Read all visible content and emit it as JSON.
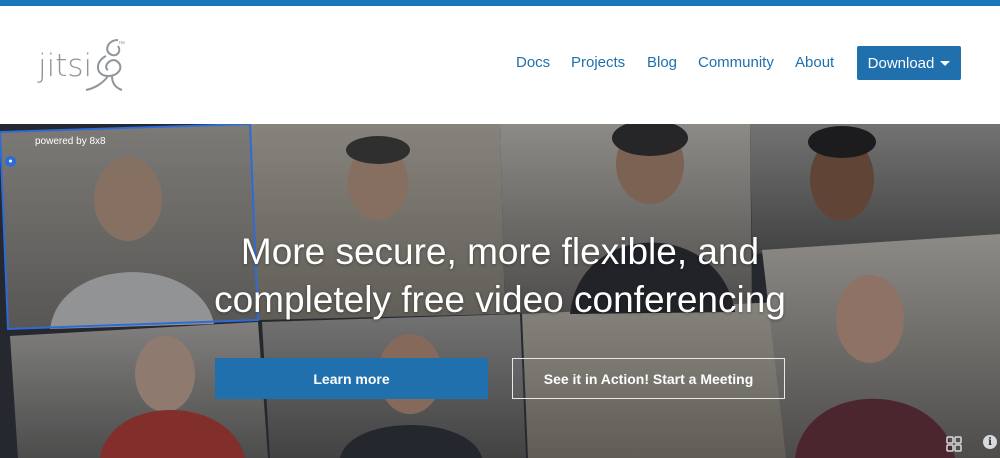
{
  "brand": {
    "logo_text": "jitsi",
    "trademark": "™"
  },
  "nav": {
    "items": [
      {
        "label": "Docs"
      },
      {
        "label": "Projects"
      },
      {
        "label": "Blog"
      },
      {
        "label": "Community"
      },
      {
        "label": "About"
      }
    ],
    "download_label": "Download"
  },
  "hero": {
    "powered_by": "powered by 8x8",
    "headline_line1": "More secure, more flexible, and",
    "headline_line2": "completely free video conferencing",
    "learn_more_label": "Learn more",
    "start_meeting_label": "See it in Action! Start a Meeting",
    "info_icon_glyph": "i"
  },
  "colors": {
    "accent": "#1d76ba",
    "nav_link": "#1f70ad",
    "hero_background": "#2c3138"
  },
  "icons": [
    "jitsi-logo-icon",
    "caret-down-icon",
    "tile-view-icon",
    "info-icon"
  ]
}
